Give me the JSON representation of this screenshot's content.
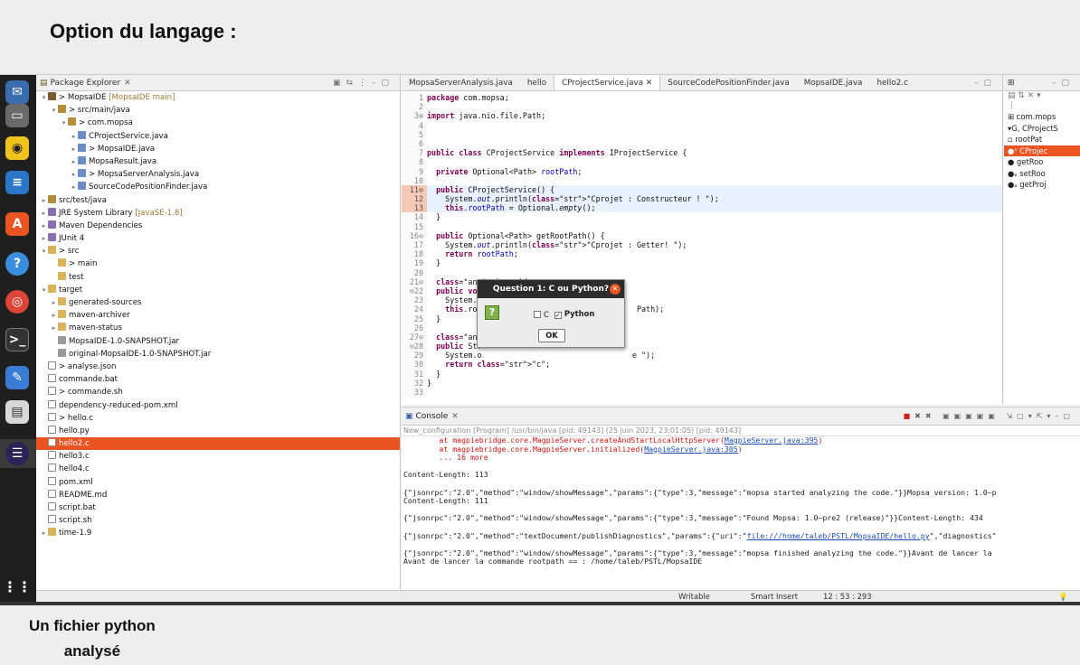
{
  "slide": {
    "title": "Option du langage :",
    "caption_line1": "Un fichier python",
    "caption_line2": "analysé"
  },
  "package_explorer": {
    "tab_label": "Package Explorer",
    "tree": [
      {
        "label": "> MopsaIDE",
        "suffix": " [MopsaIDE main]",
        "icon": "project-icon"
      },
      {
        "label": "> src/main/java",
        "icon": "source-folder-icon"
      },
      {
        "label": "> com.mopsa",
        "icon": "package-icon"
      },
      {
        "label": "CProjectService.java",
        "icon": "java-file-icon"
      },
      {
        "label": "> MopsaIDE.java",
        "icon": "java-file-icon"
      },
      {
        "label": "MopsaResult.java",
        "icon": "java-file-icon"
      },
      {
        "label": "> MopsaServerAnalysis.java",
        "icon": "java-file-icon"
      },
      {
        "label": "SourceCodePositionFinder.java",
        "icon": "java-file-icon"
      },
      {
        "label": "src/test/java",
        "icon": "source-folder-icon"
      },
      {
        "label": "JRE System Library",
        "suffix": " [JavaSE-1.8]",
        "icon": "library-icon"
      },
      {
        "label": "Maven Dependencies",
        "icon": "library-icon"
      },
      {
        "label": "JUnit 4",
        "icon": "library-icon"
      },
      {
        "label": "> src",
        "icon": "folder-icon"
      },
      {
        "label": "> main",
        "icon": "folder-icon"
      },
      {
        "label": "test",
        "icon": "folder-icon"
      },
      {
        "label": "target",
        "icon": "folder-icon"
      },
      {
        "label": "generated-sources",
        "icon": "folder-icon"
      },
      {
        "label": "maven-archiver",
        "icon": "folder-icon"
      },
      {
        "label": "maven-status",
        "icon": "folder-icon"
      },
      {
        "label": "MopsaIDE-1.0-SNAPSHOT.jar",
        "icon": "jar-icon"
      },
      {
        "label": "original-MopsaIDE-1.0-SNAPSHOT.jar",
        "icon": "jar-icon"
      },
      {
        "label": "> analyse.json",
        "icon": "file-icon"
      },
      {
        "label": "commande.bat",
        "icon": "file-icon"
      },
      {
        "label": "> commande.sh",
        "icon": "file-icon"
      },
      {
        "label": "dependency-reduced-pom.xml",
        "icon": "file-icon"
      },
      {
        "label": "> hello.c",
        "icon": "file-icon"
      },
      {
        "label": "hello.py",
        "icon": "file-icon"
      },
      {
        "label": "hello2.c",
        "icon": "file-icon"
      },
      {
        "label": "hello3.c",
        "icon": "file-icon"
      },
      {
        "label": "hello4.c",
        "icon": "file-icon"
      },
      {
        "label": "pom.xml",
        "icon": "file-icon"
      },
      {
        "label": "README.md",
        "icon": "file-icon"
      },
      {
        "label": "script.bat",
        "icon": "file-icon"
      },
      {
        "label": "script.sh",
        "icon": "file-icon"
      },
      {
        "label": "time-1.9",
        "icon": "folder-icon"
      }
    ]
  },
  "editor": {
    "tabs": [
      "MopsaServerAnalysis.java",
      "hello",
      "CProjectService.java",
      "SourceCodePositionFinder.java",
      "MopsaIDE.java",
      "hello2.c"
    ],
    "active_tab": "CProjectService.java",
    "lines": [
      "package com.mopsa;",
      "",
      "import java.nio.file.Path;",
      "",
      "",
      "",
      "public class CProjectService implements IProjectService {",
      "",
      "  private Optional<Path> rootPath;",
      "",
      "  public CProjectService() {",
      "    System.out.println(\"Cprojet : Constructeur ! \");",
      "    this.rootPath = Optional.empty();",
      "  }",
      "",
      "  public Optional<Path> getRootPath() {",
      "    System.out.println(\"Cprojet : Getter! \");",
      "    return rootPath;",
      "  }",
      "",
      "  @Override",
      "  public void setRootPath(Path rootPath) {",
      "    System.o",
      "    this.roo                                  Path);",
      "  }",
      "",
      "  @Override",
      "  public Str",
      "    System.o                                 e \");",
      "    return \"c\";",
      "  }",
      "}",
      ""
    ]
  },
  "dialog": {
    "title": "Question 1: C ou Python?",
    "option_c": "C",
    "option_python": "Python",
    "ok": "OK",
    "icon_text": "?"
  },
  "console": {
    "tab_label": "Console",
    "path": "New_configuration [Program] /usr/bin/java [pid: 49143] (25 juin 2023, 23:01:05) [pid: 49143]",
    "err1_pre": "        at magpiebridge.core.MagpieServer.createAndStartLocalHttpServer(",
    "err1_link": "MagpieServer.java:395",
    "err2_pre": "        at magpiebridge.core.MagpieServer.initialized(",
    "err2_link": "MagpieServer.java:305",
    "err3": "        ... 16 more",
    "l1": "Content-Length: 113",
    "l2": "{\"jsonrpc\":\"2.0\",\"method\":\"window/showMessage\",\"params\":{\"type\":3,\"message\":\"mopsa started analyzing the code.\"}}Mopsa version: 1.0~p",
    "l3": "Content-Length: 111",
    "l4": "{\"jsonrpc\":\"2.0\",\"method\":\"window/showMessage\",\"params\":{\"type\":3,\"message\":\"Found Mopsa: 1.0~pre2 (release)\"}}Content-Length: 434",
    "l5_pre": "{\"jsonrpc\":\"2.0\",\"method\":\"textDocument/publishDiagnostics\",\"params\":{\"uri\":\"",
    "l5_link": "file:///home/taleb/PSTL/MopsaIDE/hello.py",
    "l5_post": "\",\"diagnostics\"",
    "l6": "{\"jsonrpc\":\"2.0\",\"method\":\"window/showMessage\",\"params\":{\"type\":3,\"message\":\"mopsa finished analyzing the code.\"}}Avant de lancer la",
    "l7": "Avant de lancer la commande rootpath == : /home/taleb/PSTL/MopsaIDE"
  },
  "outline": {
    "rows": [
      "com.mops",
      "CProjectS",
      "rootPat",
      "CProjec",
      "getRoo",
      "setRoo",
      "getProj"
    ]
  },
  "status": {
    "mode": "Writable",
    "insert": "Smart Insert",
    "position": "12 : 53 : 293"
  }
}
